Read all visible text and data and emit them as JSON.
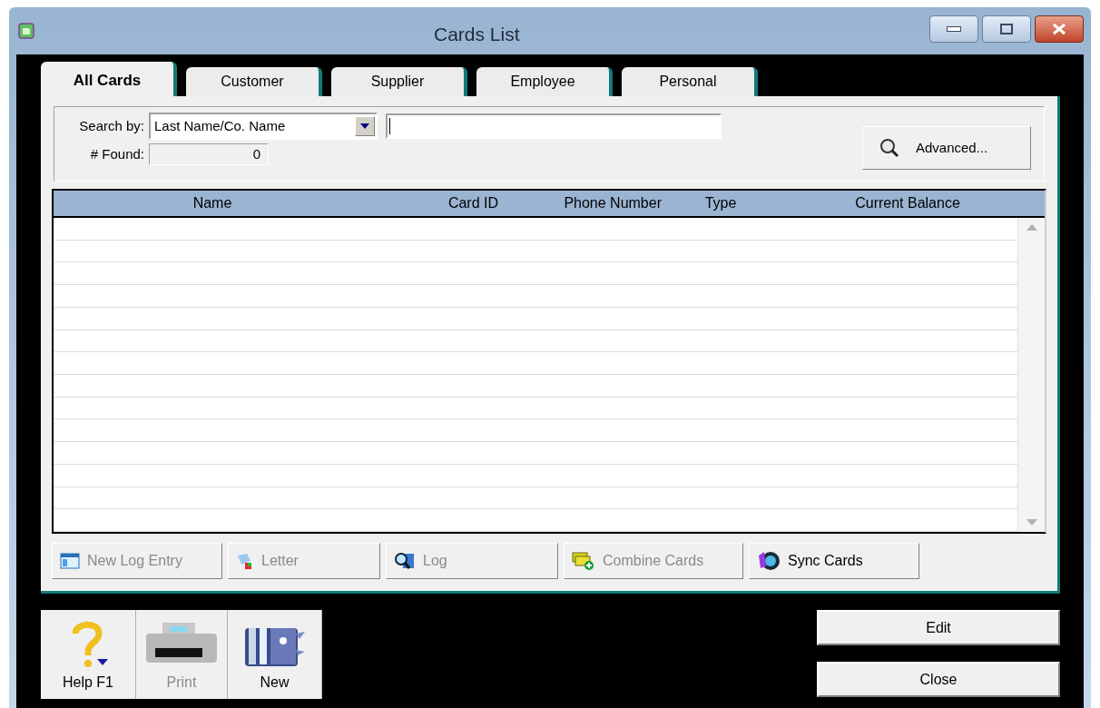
{
  "window": {
    "title": "Cards List"
  },
  "tabs": [
    {
      "label": "All Cards",
      "selected": true
    },
    {
      "label": "Customer",
      "selected": false
    },
    {
      "label": "Supplier",
      "selected": false
    },
    {
      "label": "Employee",
      "selected": false
    },
    {
      "label": "Personal",
      "selected": false
    }
  ],
  "search": {
    "label": "Search by:",
    "field": "Last Name/Co. Name",
    "found_label": "# Found:",
    "found": "0",
    "advanced_button": "Advanced..."
  },
  "table": {
    "columns": [
      "Name",
      "Card ID",
      "Phone Number",
      "Type",
      "Current Balance"
    ]
  },
  "actions": [
    {
      "kind": "log-entry",
      "label": "New Log Entry",
      "disabled": true
    },
    {
      "kind": "letter",
      "label": "Letter",
      "disabled": true
    },
    {
      "kind": "log",
      "label": "Log",
      "disabled": true
    },
    {
      "kind": "combine",
      "label": "Combine Cards",
      "disabled": true
    },
    {
      "kind": "sync",
      "label": "Sync Cards",
      "disabled": false
    }
  ],
  "toolbar": [
    {
      "kind": "help",
      "label": "Help F1",
      "disabled": false
    },
    {
      "kind": "print",
      "label": "Print",
      "disabled": true
    },
    {
      "kind": "new",
      "label": "New",
      "disabled": false
    }
  ],
  "buttons": [
    "Edit",
    "Close"
  ]
}
